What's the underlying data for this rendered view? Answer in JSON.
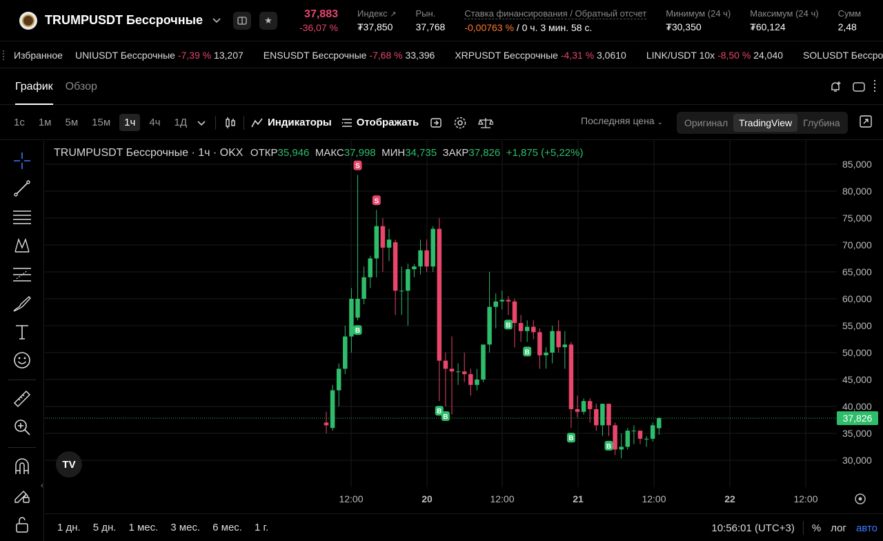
{
  "header": {
    "symbol_title": "TRUMPUSDT Бессрочные",
    "last_price": "37,883",
    "change_pct": "-36,07 %",
    "stats": [
      {
        "label": "Индекс",
        "value": "₮37,850"
      },
      {
        "label": "Рын.",
        "value": "37,768"
      },
      {
        "label": "Ставка финансирования / Обратный отсчет",
        "value_neg": "-0,00763 %",
        "value_rest": " / 0 ч. 3 мин. 58 с."
      },
      {
        "label": "Минимум (24 ч)",
        "value": "₮30,350"
      },
      {
        "label": "Максимум (24 ч)",
        "value": "₮60,124"
      },
      {
        "label": "Сумм",
        "value": "2,48"
      }
    ]
  },
  "favorites": {
    "label": "Избранное",
    "items": [
      {
        "name": "UNIUSDT Бессрочные",
        "change": "-7,39 %",
        "price": "13,207"
      },
      {
        "name": "ENSUSDT Бессрочные",
        "change": "-7,68 %",
        "price": "33,396"
      },
      {
        "name": "XRPUSDT Бессрочные",
        "change": "-4,31 %",
        "price": "3,0610"
      },
      {
        "name": "LINK/USDT 10x",
        "change": "-8,50 %",
        "price": "24,040"
      },
      {
        "name": "SOLUSDT Бессрочные",
        "change": "",
        "price": ""
      }
    ]
  },
  "tabs": [
    "График",
    "Обзор"
  ],
  "toolbar": {
    "timeframes": [
      "1с",
      "1м",
      "5м",
      "15м",
      "1ч",
      "4ч",
      "1Д"
    ],
    "active_timeframe": "1ч",
    "indicators_label": "Индикаторы",
    "display_label": "Отображать",
    "last_price_label": "Последняя цена",
    "views": [
      "Оригинал",
      "TradingView",
      "Глубина"
    ],
    "active_view": "TradingView"
  },
  "legend": {
    "title": "TRUMPUSDT Бессрочные · 1ч · OKX",
    "open_label": "ОТКР",
    "open": "35,946",
    "high_label": "МАКС",
    "high": "37,998",
    "low_label": "МИН",
    "low": "34,735",
    "close_label": "ЗАКР",
    "close": "37,826",
    "change": "+1,875 (+5,22%)"
  },
  "bottom": {
    "ranges": [
      "1 дн.",
      "5 дн.",
      "1 мес.",
      "3 мес.",
      "6 мес.",
      "1 г."
    ],
    "time": "10:56:01 (UTC+3)",
    "pct": "%",
    "log": "лог",
    "auto": "авто"
  },
  "colors": {
    "up": "#2ebd6b",
    "down": "#e8466a",
    "accent": "#3d7bff",
    "funding_neg": "#ff7a2e"
  },
  "chart_data": {
    "type": "candlestick",
    "interval": "1ч",
    "ylim": [
      27000,
      87000
    ],
    "y_ticks": [
      "85,000",
      "80,000",
      "75,000",
      "70,000",
      "65,000",
      "60,000",
      "55,000",
      "50,000",
      "45,000",
      "40,000",
      "35,000",
      "30,000"
    ],
    "x_ticks": [
      "12:00",
      "20",
      "12:00",
      "21",
      "12:00",
      "22",
      "12:00"
    ],
    "last_price_label": "37,826",
    "candles": [
      {
        "o": 37000,
        "h": 39000,
        "l": 35000,
        "c": 36500
      },
      {
        "o": 36000,
        "h": 44000,
        "l": 35500,
        "c": 43000
      },
      {
        "o": 43000,
        "h": 48000,
        "l": 40000,
        "c": 47000
      },
      {
        "o": 47000,
        "h": 55000,
        "l": 46000,
        "c": 53000
      },
      {
        "o": 53000,
        "h": 62000,
        "l": 50000,
        "c": 60000
      },
      {
        "o": 56500,
        "h": 83000,
        "l": 56000,
        "c": 60000
      },
      {
        "o": 60000,
        "h": 66000,
        "l": 59000,
        "c": 64000
      },
      {
        "o": 64000,
        "h": 68000,
        "l": 62000,
        "c": 67500
      },
      {
        "o": 67500,
        "h": 76500,
        "l": 64000,
        "c": 73500
      },
      {
        "o": 73500,
        "h": 75000,
        "l": 65000,
        "c": 69500
      },
      {
        "o": 69500,
        "h": 73000,
        "l": 67000,
        "c": 71000
      },
      {
        "o": 70500,
        "h": 71000,
        "l": 57000,
        "c": 61500
      },
      {
        "o": 61500,
        "h": 66000,
        "l": 57000,
        "c": 61500
      },
      {
        "o": 61500,
        "h": 66500,
        "l": 55000,
        "c": 65500
      },
      {
        "o": 65500,
        "h": 66500,
        "l": 64000,
        "c": 66000
      },
      {
        "o": 66000,
        "h": 71000,
        "l": 64500,
        "c": 69000
      },
      {
        "o": 69000,
        "h": 71000,
        "l": 65000,
        "c": 66000
      },
      {
        "o": 66000,
        "h": 73500,
        "l": 65000,
        "c": 73000
      },
      {
        "o": 73000,
        "h": 75000,
        "l": 41000,
        "c": 48500
      },
      {
        "o": 48500,
        "h": 50000,
        "l": 40000,
        "c": 47000
      },
      {
        "o": 47000,
        "h": 53000,
        "l": 38500,
        "c": 46500
      },
      {
        "o": 46500,
        "h": 48000,
        "l": 44000,
        "c": 46500
      },
      {
        "o": 46500,
        "h": 50000,
        "l": 44500,
        "c": 46000
      },
      {
        "o": 46000,
        "h": 47000,
        "l": 42000,
        "c": 44000
      },
      {
        "o": 44000,
        "h": 47000,
        "l": 43000,
        "c": 45000
      },
      {
        "o": 45000,
        "h": 51000,
        "l": 44500,
        "c": 51500
      },
      {
        "o": 51500,
        "h": 65000,
        "l": 50000,
        "c": 58500
      },
      {
        "o": 58500,
        "h": 61000,
        "l": 54500,
        "c": 59500
      },
      {
        "o": 59500,
        "h": 61500,
        "l": 58000,
        "c": 59800
      },
      {
        "o": 59800,
        "h": 60500,
        "l": 57000,
        "c": 59500
      },
      {
        "o": 59500,
        "h": 60000,
        "l": 51000,
        "c": 55500
      },
      {
        "o": 55500,
        "h": 57000,
        "l": 52000,
        "c": 54000
      },
      {
        "o": 54000,
        "h": 56000,
        "l": 52000,
        "c": 54800
      },
      {
        "o": 54800,
        "h": 56000,
        "l": 52500,
        "c": 53800
      },
      {
        "o": 53800,
        "h": 54500,
        "l": 47000,
        "c": 49500
      },
      {
        "o": 49500,
        "h": 51000,
        "l": 47000,
        "c": 50000
      },
      {
        "o": 50000,
        "h": 55000,
        "l": 48000,
        "c": 54000
      },
      {
        "o": 54000,
        "h": 56000,
        "l": 50000,
        "c": 51000
      },
      {
        "o": 51000,
        "h": 54000,
        "l": 47000,
        "c": 51500
      },
      {
        "o": 51500,
        "h": 52000,
        "l": 36000,
        "c": 39500
      },
      {
        "o": 39500,
        "h": 42000,
        "l": 38000,
        "c": 39000
      },
      {
        "o": 39000,
        "h": 41500,
        "l": 38500,
        "c": 41000
      },
      {
        "o": 41000,
        "h": 41500,
        "l": 37000,
        "c": 39500
      },
      {
        "o": 39500,
        "h": 40500,
        "l": 35500,
        "c": 36500
      },
      {
        "o": 36500,
        "h": 40500,
        "l": 34500,
        "c": 40500
      },
      {
        "o": 40500,
        "h": 40500,
        "l": 34500,
        "c": 36500
      },
      {
        "o": 36500,
        "h": 37000,
        "l": 31000,
        "c": 32000
      },
      {
        "o": 32000,
        "h": 35000,
        "l": 30350,
        "c": 32500
      },
      {
        "o": 32500,
        "h": 36000,
        "l": 32000,
        "c": 35500
      },
      {
        "o": 35500,
        "h": 36500,
        "l": 33000,
        "c": 35500
      },
      {
        "o": 35500,
        "h": 35500,
        "l": 33000,
        "c": 34000
      },
      {
        "o": 34000,
        "h": 34500,
        "l": 32500,
        "c": 34000
      },
      {
        "o": 34000,
        "h": 37000,
        "l": 33500,
        "c": 36500
      },
      {
        "o": 35946,
        "h": 37998,
        "l": 34735,
        "c": 37826
      }
    ],
    "markers": [
      {
        "i": 5,
        "type": "S"
      },
      {
        "i": 8,
        "type": "S"
      },
      {
        "i": 5,
        "type": "B"
      },
      {
        "i": 18,
        "type": "B"
      },
      {
        "i": 19,
        "type": "B"
      },
      {
        "i": 29,
        "type": "B"
      },
      {
        "i": 32,
        "type": "B"
      },
      {
        "i": 39,
        "type": "B"
      },
      {
        "i": 45,
        "type": "B"
      }
    ]
  }
}
